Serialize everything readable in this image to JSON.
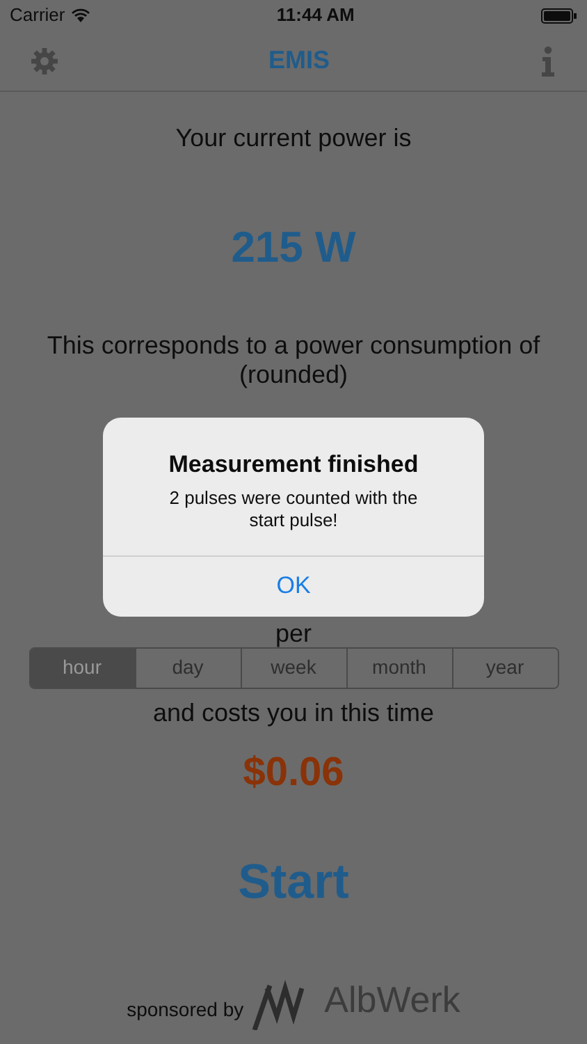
{
  "status_bar": {
    "carrier": "Carrier",
    "time": "11:44 AM"
  },
  "nav_bar": {
    "title": "EMIS"
  },
  "power": {
    "label": "Your current power is",
    "value": "215 W"
  },
  "consumption": {
    "label": "This corresponds to a power consumption of (rounded)",
    "per": "per"
  },
  "periods": [
    {
      "label": "hour",
      "selected": true
    },
    {
      "label": "day",
      "selected": false
    },
    {
      "label": "week",
      "selected": false
    },
    {
      "label": "month",
      "selected": false
    },
    {
      "label": "year",
      "selected": false
    }
  ],
  "cost": {
    "label": "and costs you in this time",
    "value": "$0.06"
  },
  "start_button": "Start",
  "sponsor": {
    "label": "sponsored by",
    "brand": "AlbWerk"
  },
  "alert": {
    "title": "Measurement finished",
    "message": "2 pulses were counted with the start pulse!",
    "button": "OK"
  }
}
